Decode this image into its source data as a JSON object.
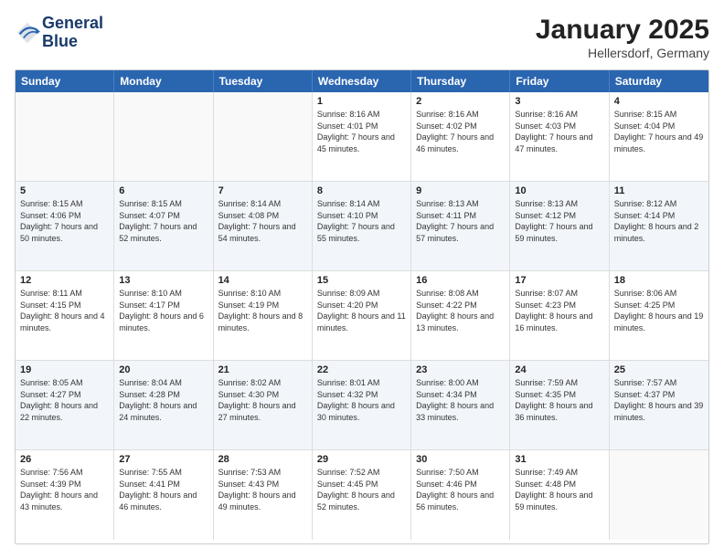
{
  "logo": {
    "line1": "General",
    "line2": "Blue"
  },
  "title": "January 2025",
  "subtitle": "Hellersdorf, Germany",
  "days_of_week": [
    "Sunday",
    "Monday",
    "Tuesday",
    "Wednesday",
    "Thursday",
    "Friday",
    "Saturday"
  ],
  "weeks": [
    [
      {
        "day": "",
        "info": ""
      },
      {
        "day": "",
        "info": ""
      },
      {
        "day": "",
        "info": ""
      },
      {
        "day": "1",
        "info": "Sunrise: 8:16 AM\nSunset: 4:01 PM\nDaylight: 7 hours and 45 minutes."
      },
      {
        "day": "2",
        "info": "Sunrise: 8:16 AM\nSunset: 4:02 PM\nDaylight: 7 hours and 46 minutes."
      },
      {
        "day": "3",
        "info": "Sunrise: 8:16 AM\nSunset: 4:03 PM\nDaylight: 7 hours and 47 minutes."
      },
      {
        "day": "4",
        "info": "Sunrise: 8:15 AM\nSunset: 4:04 PM\nDaylight: 7 hours and 49 minutes."
      }
    ],
    [
      {
        "day": "5",
        "info": "Sunrise: 8:15 AM\nSunset: 4:06 PM\nDaylight: 7 hours and 50 minutes."
      },
      {
        "day": "6",
        "info": "Sunrise: 8:15 AM\nSunset: 4:07 PM\nDaylight: 7 hours and 52 minutes."
      },
      {
        "day": "7",
        "info": "Sunrise: 8:14 AM\nSunset: 4:08 PM\nDaylight: 7 hours and 54 minutes."
      },
      {
        "day": "8",
        "info": "Sunrise: 8:14 AM\nSunset: 4:10 PM\nDaylight: 7 hours and 55 minutes."
      },
      {
        "day": "9",
        "info": "Sunrise: 8:13 AM\nSunset: 4:11 PM\nDaylight: 7 hours and 57 minutes."
      },
      {
        "day": "10",
        "info": "Sunrise: 8:13 AM\nSunset: 4:12 PM\nDaylight: 7 hours and 59 minutes."
      },
      {
        "day": "11",
        "info": "Sunrise: 8:12 AM\nSunset: 4:14 PM\nDaylight: 8 hours and 2 minutes."
      }
    ],
    [
      {
        "day": "12",
        "info": "Sunrise: 8:11 AM\nSunset: 4:15 PM\nDaylight: 8 hours and 4 minutes."
      },
      {
        "day": "13",
        "info": "Sunrise: 8:10 AM\nSunset: 4:17 PM\nDaylight: 8 hours and 6 minutes."
      },
      {
        "day": "14",
        "info": "Sunrise: 8:10 AM\nSunset: 4:19 PM\nDaylight: 8 hours and 8 minutes."
      },
      {
        "day": "15",
        "info": "Sunrise: 8:09 AM\nSunset: 4:20 PM\nDaylight: 8 hours and 11 minutes."
      },
      {
        "day": "16",
        "info": "Sunrise: 8:08 AM\nSunset: 4:22 PM\nDaylight: 8 hours and 13 minutes."
      },
      {
        "day": "17",
        "info": "Sunrise: 8:07 AM\nSunset: 4:23 PM\nDaylight: 8 hours and 16 minutes."
      },
      {
        "day": "18",
        "info": "Sunrise: 8:06 AM\nSunset: 4:25 PM\nDaylight: 8 hours and 19 minutes."
      }
    ],
    [
      {
        "day": "19",
        "info": "Sunrise: 8:05 AM\nSunset: 4:27 PM\nDaylight: 8 hours and 22 minutes."
      },
      {
        "day": "20",
        "info": "Sunrise: 8:04 AM\nSunset: 4:28 PM\nDaylight: 8 hours and 24 minutes."
      },
      {
        "day": "21",
        "info": "Sunrise: 8:02 AM\nSunset: 4:30 PM\nDaylight: 8 hours and 27 minutes."
      },
      {
        "day": "22",
        "info": "Sunrise: 8:01 AM\nSunset: 4:32 PM\nDaylight: 8 hours and 30 minutes."
      },
      {
        "day": "23",
        "info": "Sunrise: 8:00 AM\nSunset: 4:34 PM\nDaylight: 8 hours and 33 minutes."
      },
      {
        "day": "24",
        "info": "Sunrise: 7:59 AM\nSunset: 4:35 PM\nDaylight: 8 hours and 36 minutes."
      },
      {
        "day": "25",
        "info": "Sunrise: 7:57 AM\nSunset: 4:37 PM\nDaylight: 8 hours and 39 minutes."
      }
    ],
    [
      {
        "day": "26",
        "info": "Sunrise: 7:56 AM\nSunset: 4:39 PM\nDaylight: 8 hours and 43 minutes."
      },
      {
        "day": "27",
        "info": "Sunrise: 7:55 AM\nSunset: 4:41 PM\nDaylight: 8 hours and 46 minutes."
      },
      {
        "day": "28",
        "info": "Sunrise: 7:53 AM\nSunset: 4:43 PM\nDaylight: 8 hours and 49 minutes."
      },
      {
        "day": "29",
        "info": "Sunrise: 7:52 AM\nSunset: 4:45 PM\nDaylight: 8 hours and 52 minutes."
      },
      {
        "day": "30",
        "info": "Sunrise: 7:50 AM\nSunset: 4:46 PM\nDaylight: 8 hours and 56 minutes."
      },
      {
        "day": "31",
        "info": "Sunrise: 7:49 AM\nSunset: 4:48 PM\nDaylight: 8 hours and 59 minutes."
      },
      {
        "day": "",
        "info": ""
      }
    ]
  ]
}
